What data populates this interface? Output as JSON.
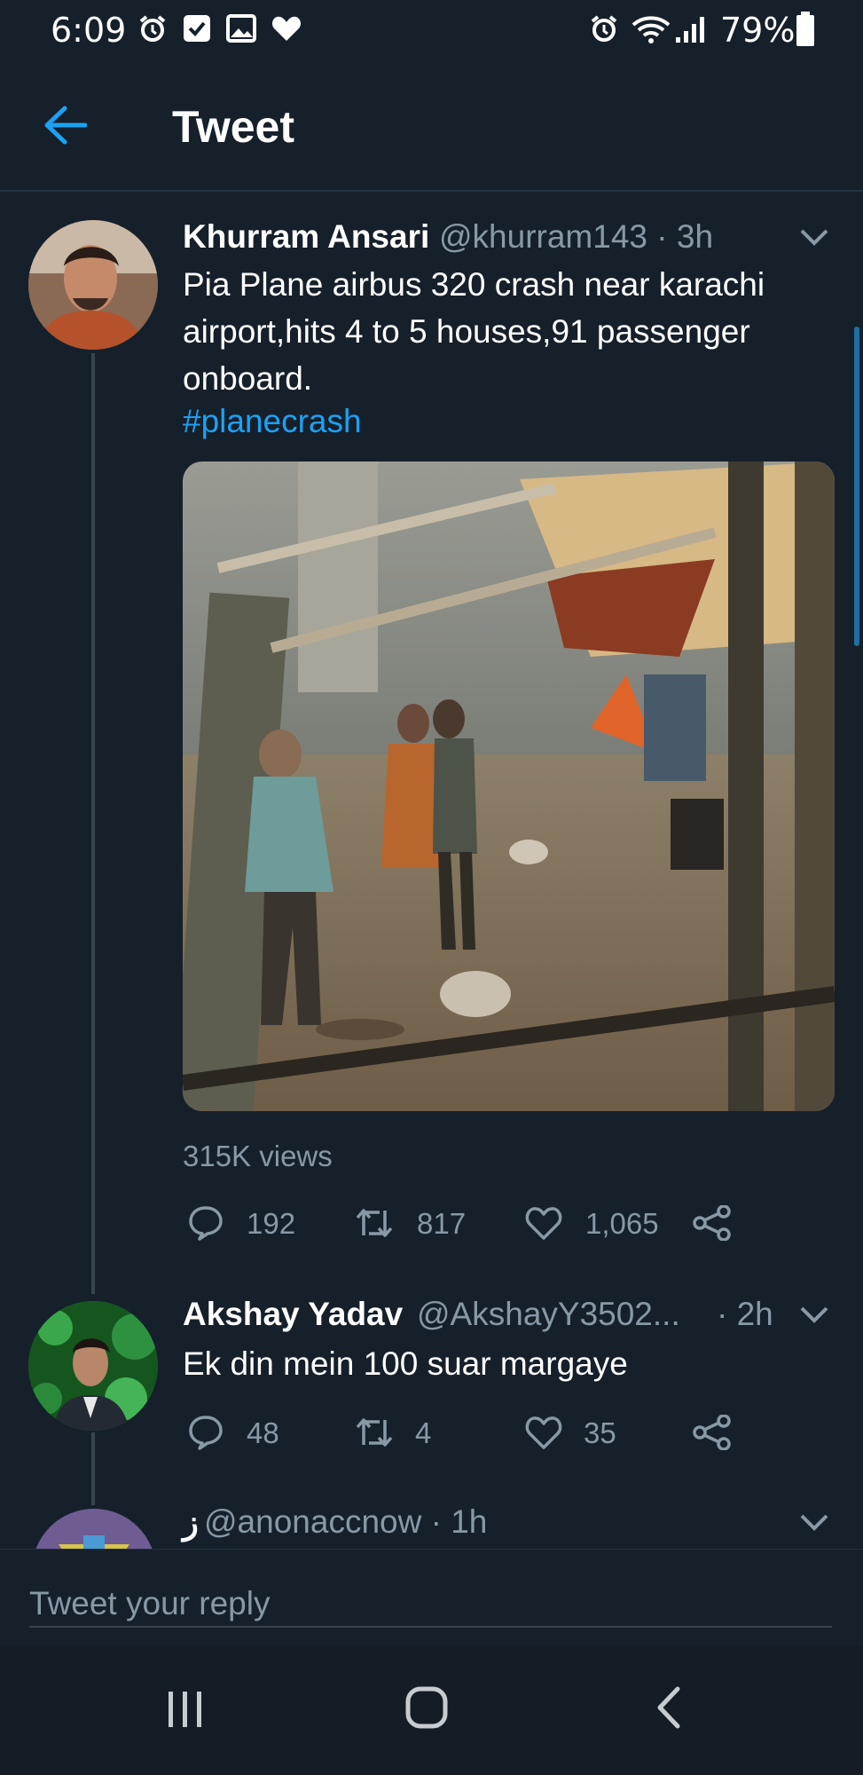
{
  "status_bar": {
    "time": "6:09",
    "battery": "79%"
  },
  "header": {
    "title": "Tweet"
  },
  "main_tweet": {
    "name": "Khurram Ansari",
    "handle": "@khurram143 · 3h",
    "text": "Pia Plane airbus 320 crash near karachi airport,hits 4 to 5 houses,91 passenger onboard.",
    "hashtag": "#planecrash",
    "views": "315K views",
    "replies": "192",
    "retweets": "817",
    "likes": "1,065"
  },
  "reply_1": {
    "name": "Akshay Yadav",
    "handle": "@AkshayY3502...",
    "time": "· 2h",
    "text": "Ek din mein 100 suar margaye",
    "replies": "48",
    "retweets": "4",
    "likes": "35"
  },
  "reply_2": {
    "name": "ز",
    "handle": "@anonaccnow · 1h"
  },
  "reply_box": {
    "placeholder": "Tweet your reply"
  },
  "colors": {
    "background": "#15202b",
    "accent": "#1da1f2",
    "muted": "#8899a6"
  },
  "icons": [
    "alarm-icon",
    "check-icon",
    "image-icon",
    "heart-icon",
    "wifi-icon",
    "signal-icon",
    "battery-icon",
    "back-arrow-icon",
    "chevron-down-icon",
    "reply-icon",
    "retweet-icon",
    "like-icon",
    "share-icon",
    "recent-apps-icon",
    "home-icon",
    "back-icon"
  ]
}
